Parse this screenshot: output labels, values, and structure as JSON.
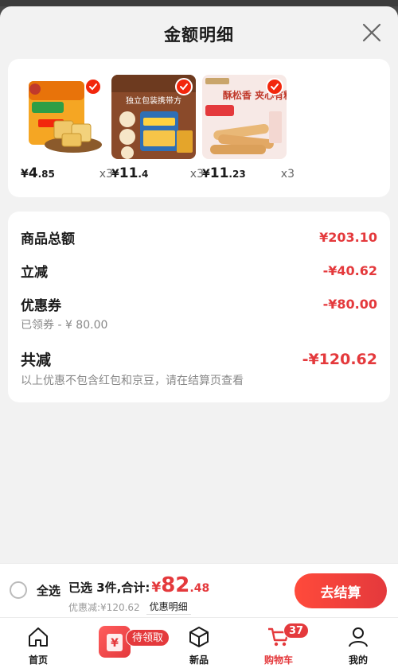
{
  "sheet": {
    "title": "金额明细"
  },
  "products": [
    {
      "price_currency": "¥",
      "price_int": "4",
      "price_dec": ".85",
      "qty": "x3",
      "image": "peanut-bar-snack-pack"
    },
    {
      "price_currency": "¥",
      "price_int": "11",
      "price_dec": ".4",
      "qty": "x3",
      "image": "brown-snack-bag",
      "image_text": "独立包装携带方"
    },
    {
      "price_currency": "¥",
      "price_int": "11",
      "price_dec": ".23",
      "qty": "x3",
      "image": "crispy-rolls",
      "image_text": "酥松香 夹心有料"
    }
  ],
  "summary": {
    "total_label": "商品总额",
    "total_value": "¥203.10",
    "instant_label": "立减",
    "instant_value": "-¥40.62",
    "coupon_label": "优惠券",
    "coupon_value": "-¥80.00",
    "coupon_note": "已领券 - ¥ 80.00",
    "combined_label": "共减",
    "combined_value": "-¥120.62",
    "footnote": "以上优惠不包含红包和京豆，请在结算页查看"
  },
  "bottom_bar": {
    "select_all": "全选",
    "selected_text": "已选 3件,合计:",
    "total_currency": "¥",
    "total_int": "82",
    "total_dec": ".48",
    "saved_text": "优惠减:¥120.62",
    "detail_link": "优惠明细",
    "checkout": "去结算"
  },
  "tabbar": {
    "home": "首页",
    "promo_badge": "待领取",
    "new": "新品",
    "cart": "购物车",
    "cart_count": "37",
    "mine": "我的"
  },
  "colors": {
    "accent": "#e4393c",
    "background": "#f2f2f2"
  }
}
